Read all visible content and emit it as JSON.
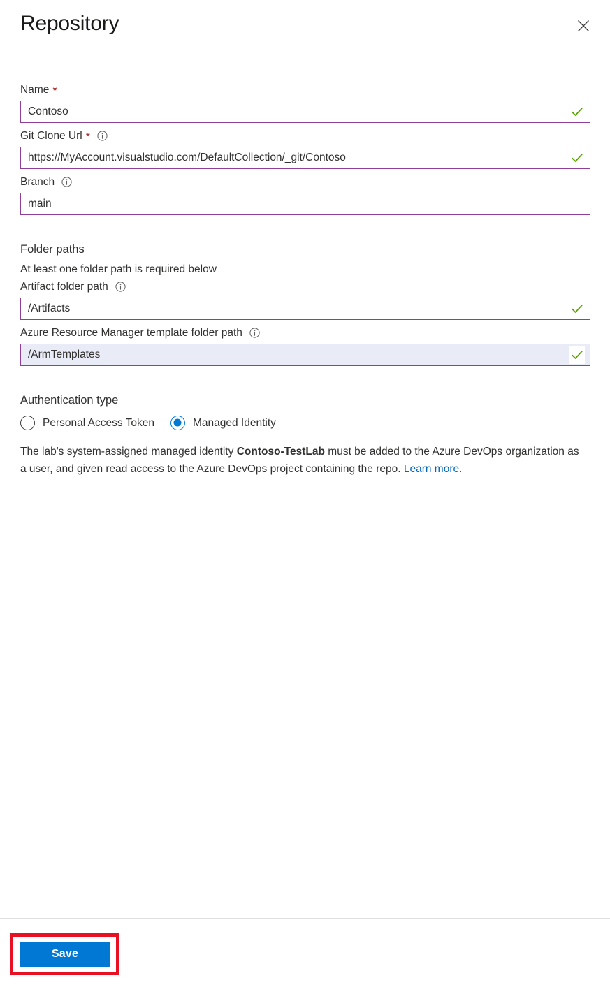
{
  "header": {
    "title": "Repository",
    "close_label": "Close"
  },
  "form": {
    "name": {
      "label": "Name",
      "required": true,
      "value": "Contoso",
      "valid": true
    },
    "git_clone_url": {
      "label": "Git Clone Url",
      "required": true,
      "has_info": true,
      "value": "https://MyAccount.visualstudio.com/DefaultCollection/_git/Contoso",
      "valid": true
    },
    "branch": {
      "label": "Branch",
      "has_info": true,
      "value": "main",
      "valid": false
    },
    "folder_paths": {
      "heading": "Folder paths",
      "note": "At least one folder path is required below",
      "artifact": {
        "label": "Artifact folder path",
        "has_info": true,
        "value": "/Artifacts",
        "valid": true
      },
      "arm_template": {
        "label": "Azure Resource Manager template folder path",
        "has_info": true,
        "value": "/ArmTemplates",
        "valid": true,
        "focused": true
      }
    },
    "authentication": {
      "heading": "Authentication type",
      "options": [
        {
          "label": "Personal Access Token",
          "selected": false
        },
        {
          "label": "Managed Identity",
          "selected": true
        }
      ],
      "description_part1": "The lab's system-assigned managed identity ",
      "description_bold": "Contoso-TestLab",
      "description_part2": " must be added to the Azure DevOps organization as a user, and given read access to the Azure DevOps project containing the repo. ",
      "description_link": "Learn more."
    }
  },
  "footer": {
    "save_label": "Save"
  },
  "colors": {
    "input_border": "#8f3f97",
    "valid_check": "#5ba300",
    "accent_blue": "#0078d4",
    "link_blue": "#0067b8",
    "required_star": "#a4262c",
    "highlight_red": "#e81123",
    "focused_field_bg": "#e9ebf7"
  },
  "icons": {
    "close": "close-icon",
    "info": "info-icon",
    "check": "check-icon"
  }
}
